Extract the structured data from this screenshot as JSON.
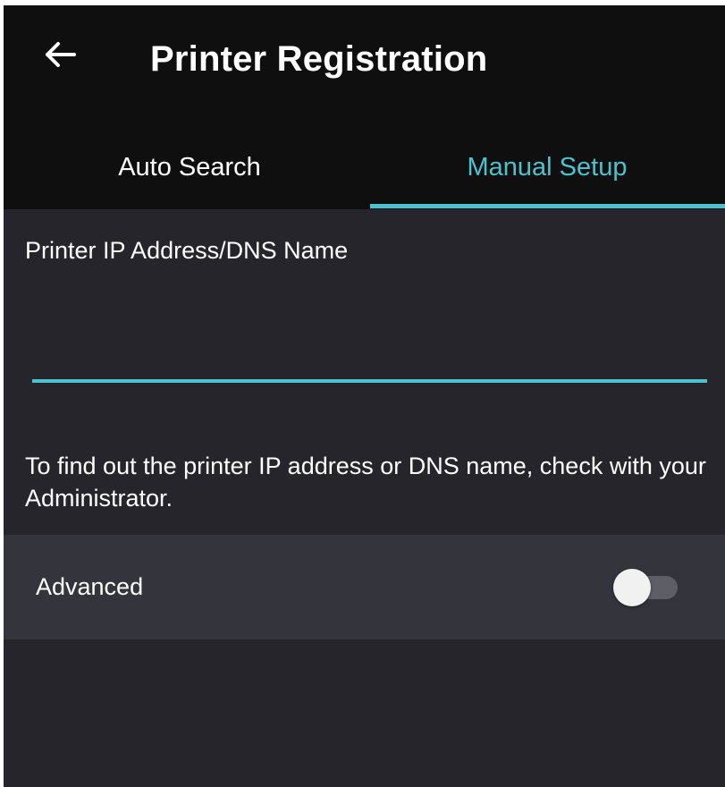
{
  "app_bar": {
    "title": "Printer Registration",
    "back_icon": "arrow-left-icon"
  },
  "tabs": [
    {
      "label": "Auto Search",
      "selected": false
    },
    {
      "label": "Manual Setup",
      "selected": true
    }
  ],
  "form": {
    "ip_label": "Printer IP Address/DNS Name",
    "ip_value": "",
    "ip_placeholder": "",
    "hint": "To find out the printer IP address or DNS name, check with your Administrator."
  },
  "advanced": {
    "label": "Advanced",
    "enabled": false
  },
  "colors": {
    "accent": "#4dc2cf",
    "app_bar_background": "#0f0f10",
    "content_background": "#25252b",
    "row_background": "#34353c"
  }
}
